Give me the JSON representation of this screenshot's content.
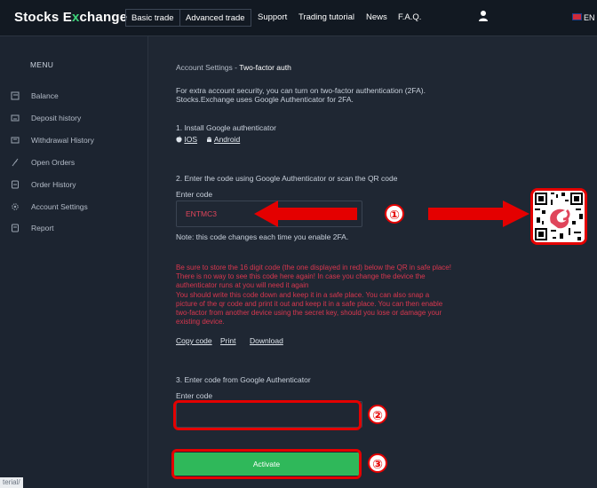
{
  "header": {
    "logo_part1": "Stocks E",
    "logo_x": "x",
    "logo_part2": "change",
    "tabs": [
      {
        "label": "Basic trade"
      },
      {
        "label": "Advanced trade"
      }
    ],
    "links": [
      {
        "label": "Support"
      },
      {
        "label": "Trading tutorial"
      },
      {
        "label": "News"
      },
      {
        "label": "F.A.Q."
      }
    ],
    "user_icon": "user-icon",
    "language": "EN"
  },
  "sidebar": {
    "title": "MENU",
    "items": [
      {
        "label": "Balance",
        "icon": "wallet-icon"
      },
      {
        "label": "Deposit history",
        "icon": "deposit-icon"
      },
      {
        "label": "Withdrawal History",
        "icon": "withdrawal-icon"
      },
      {
        "label": "Open Orders",
        "icon": "feather-icon"
      },
      {
        "label": "Order History",
        "icon": "document-icon"
      },
      {
        "label": "Account Settings",
        "icon": "gear-icon"
      },
      {
        "label": "Report",
        "icon": "report-icon"
      }
    ],
    "footer_text": "terial/"
  },
  "breadcrumb": {
    "parent": "Account Settings",
    "separator": "-",
    "current": "Two-factor auth"
  },
  "intro": {
    "line1": "For extra account security, you can turn on two-factor authentication (2FA).",
    "line2": "Stocks.Exchange uses Google Authenticator for 2FA."
  },
  "step1": {
    "title": "1. Install Google authenticator",
    "ios": "IOS",
    "android": "Android"
  },
  "step2": {
    "title": "2. Enter the code using Google Authenticator or scan the QR code",
    "code_label": "Enter code",
    "code_value": "ENTMC3",
    "note": "Note: this code changes each time you enable 2FA."
  },
  "warning": {
    "lines": [
      "Be sure to store the 16 digit code (the one displayed in red) below the QR in safe place!",
      "There is no way to see this code here again! In case you change the device the",
      "authenticator runs at you will need it again",
      "You should write this code down and keep it in a safe place. You can also snap a",
      "picture of the qr code and print it out and keep it in a safe place. You can then enable",
      "two-factor from another device using the secret key, should you lose or damage your",
      "existing device."
    ]
  },
  "actions": {
    "copy": "Copy code",
    "print": "Print",
    "download": "Download"
  },
  "step3": {
    "title": "3. Enter code from Google Authenticator",
    "code_label": "Enter code",
    "code_value": "",
    "button": "Activate"
  },
  "annotations": {
    "n1": "①",
    "n2": "②",
    "n3": "③",
    "color": "#e40000"
  },
  "colors": {
    "background": "#1f2733",
    "topbar": "#121922",
    "accent_green": "#2fb85a",
    "warning_red": "#d9374f"
  }
}
